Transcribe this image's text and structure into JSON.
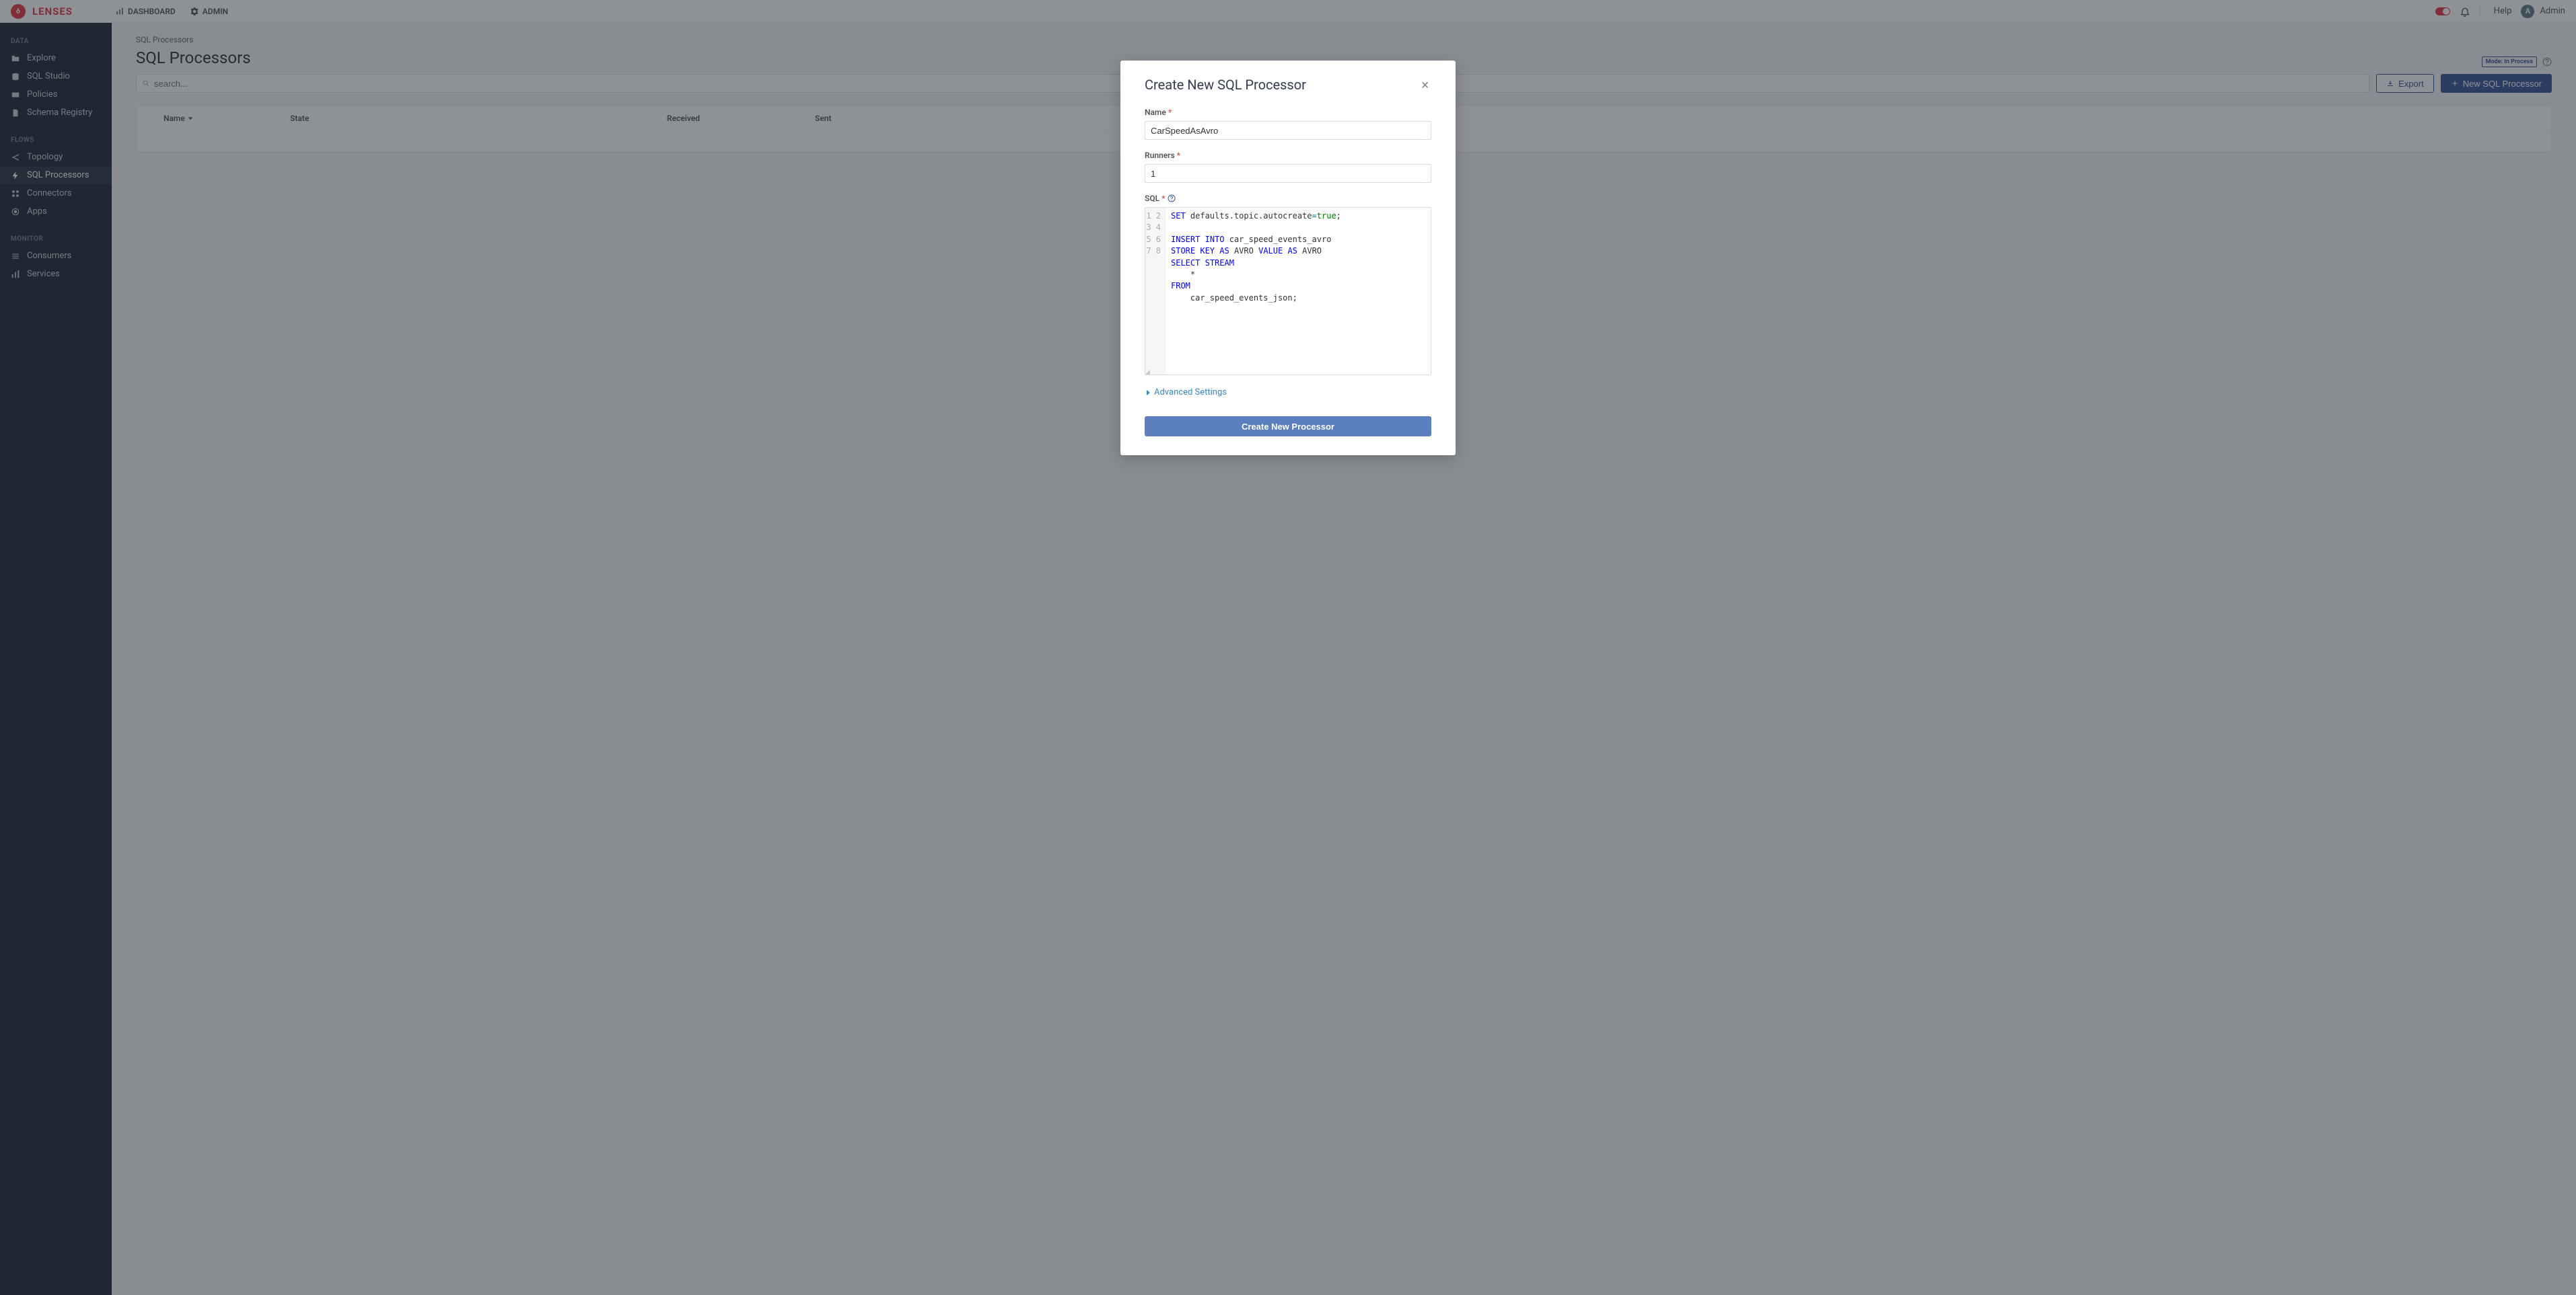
{
  "brand": "LENSES",
  "topnav": {
    "dashboard": "DASHBOARD",
    "admin": "ADMIN"
  },
  "topbar": {
    "help": "Help",
    "user_initial": "A",
    "user_name": "Admin"
  },
  "sidebar": {
    "section_data": "DATA",
    "items_data": [
      "Explore",
      "SQL Studio",
      "Policies",
      "Schema Registry"
    ],
    "section_flows": "FLOWS",
    "items_flows": [
      "Topology",
      "SQL Processors",
      "Connectors",
      "Apps"
    ],
    "section_monitor": "MONITOR",
    "items_monitor": [
      "Consumers",
      "Services"
    ]
  },
  "page": {
    "breadcrumb": "SQL Processors",
    "title": "SQL Processors",
    "mode_badge": "Mode: In Process",
    "search_placeholder": "search...",
    "export_btn": "Export",
    "new_btn": "New SQL Processor",
    "columns": {
      "name": "Name",
      "state": "State",
      "received": "Received",
      "sent": "Sent"
    }
  },
  "modal": {
    "title": "Create New SQL Processor",
    "name_label": "Name",
    "name_value": "CarSpeedAsAvro",
    "runners_label": "Runners",
    "runners_value": "1",
    "sql_label": "SQL",
    "sql_lines": [
      [
        {
          "t": "SET",
          "c": "kw"
        },
        {
          "t": " defaults.topic.autocreate"
        },
        {
          "t": "=",
          "c": "op"
        },
        {
          "t": "true",
          "c": "lit"
        },
        {
          "t": ";"
        }
      ],
      [],
      [
        {
          "t": "INSERT",
          "c": "kw"
        },
        {
          "t": " "
        },
        {
          "t": "INTO",
          "c": "kw"
        },
        {
          "t": " car_speed_events_avro"
        }
      ],
      [
        {
          "t": "STORE",
          "c": "kw"
        },
        {
          "t": " "
        },
        {
          "t": "KEY",
          "c": "kw"
        },
        {
          "t": " "
        },
        {
          "t": "AS",
          "c": "kw"
        },
        {
          "t": " AVRO "
        },
        {
          "t": "VALUE",
          "c": "kw"
        },
        {
          "t": " "
        },
        {
          "t": "AS",
          "c": "kw"
        },
        {
          "t": " AVRO"
        }
      ],
      [
        {
          "t": "SELECT",
          "c": "kw"
        },
        {
          "t": " "
        },
        {
          "t": "STREAM",
          "c": "kw"
        }
      ],
      [
        {
          "t": "    *"
        }
      ],
      [
        {
          "t": "FROM",
          "c": "kw"
        }
      ],
      [
        {
          "t": "    car_speed_events_json;"
        }
      ]
    ],
    "advanced": "Advanced Settings",
    "submit": "Create New Processor"
  }
}
